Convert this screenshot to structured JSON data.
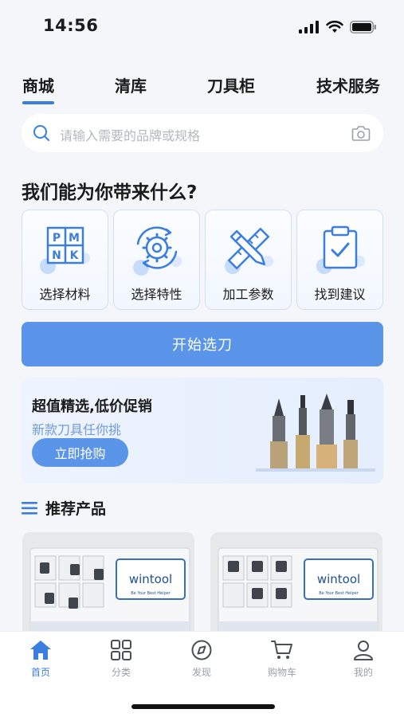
{
  "status": {
    "time": "14:56"
  },
  "tabs": [
    {
      "label": "商城",
      "active": true
    },
    {
      "label": "清库"
    },
    {
      "label": "刀具柜"
    },
    {
      "label": "技术服务"
    }
  ],
  "search": {
    "placeholder": "请输入需要的品牌或规格"
  },
  "section_title": "我们能为你带来什么?",
  "features": [
    {
      "label": "选择材料",
      "icon": "pmnk-icon",
      "letters": [
        "P",
        "M",
        "N",
        "K"
      ]
    },
    {
      "label": "选择特性",
      "icon": "gear-cycle-icon"
    },
    {
      "label": "加工参数",
      "icon": "ruler-pencil-icon"
    },
    {
      "label": "找到建议",
      "icon": "clipboard-check-icon"
    }
  ],
  "start_button": "开始选刀",
  "promo": {
    "title": "超值精选,低价促销",
    "subtitle": "新款刀具任你挑",
    "button": "立即抢购"
  },
  "recommend_title": "推荐产品",
  "products": [
    {
      "brand": "wintool",
      "tagline": "Be Your Best Helper"
    },
    {
      "brand": "wintool",
      "tagline": "Be Your Best Helper"
    }
  ],
  "tabbar": [
    {
      "label": "首页",
      "icon": "home-icon",
      "active": true
    },
    {
      "label": "分类",
      "icon": "grid-icon"
    },
    {
      "label": "发现",
      "icon": "compass-icon"
    },
    {
      "label": "购物车",
      "icon": "cart-icon"
    },
    {
      "label": "我的",
      "icon": "user-icon"
    }
  ],
  "colors": {
    "accent": "#3a7ee0",
    "button": "#5b95ea",
    "background": "#f4f6fa"
  }
}
